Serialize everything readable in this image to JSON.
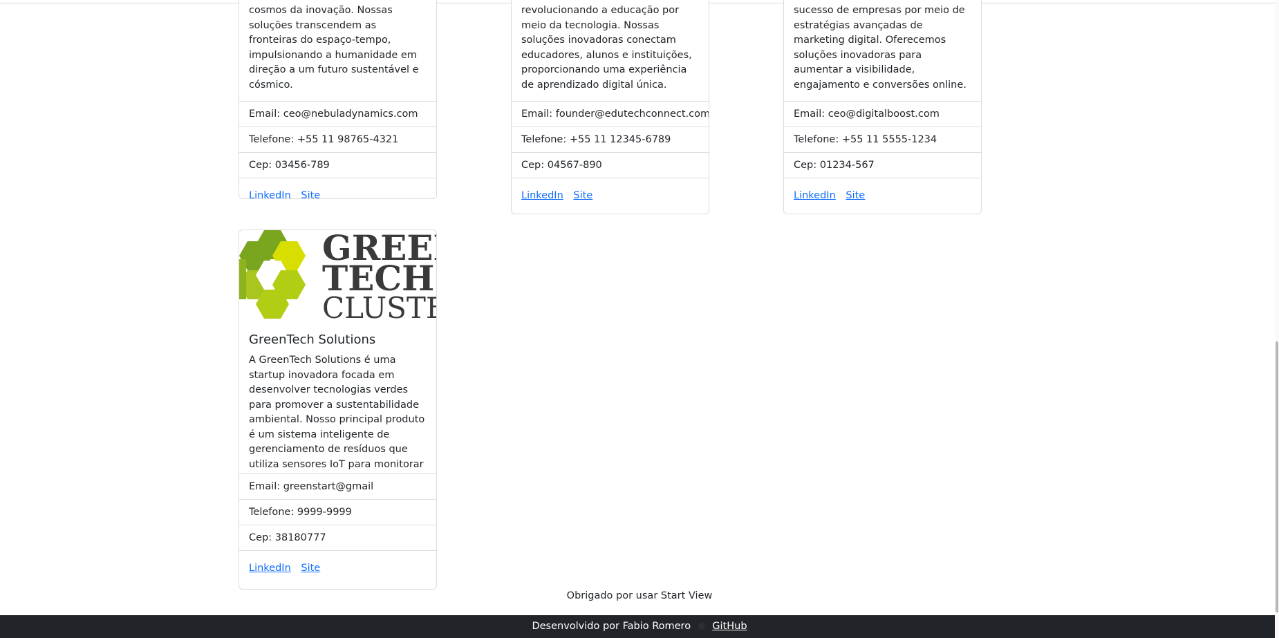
{
  "cards": [
    {
      "text": "cosmos da inovação. Nossas soluções transcendem as fronteiras do espaço-tempo, impulsionando a humanidade em direção a um futuro sustentável e cósmico.",
      "email": "Email: ceo@nebuladynamics.com",
      "phone": "Telefone: +55 11 98765-4321",
      "cep": "Cep: 03456-789",
      "linkedin": "LinkedIn",
      "site": "Site"
    },
    {
      "text": "revolucionando a educação por meio da tecnologia. Nossas soluções inovadoras conectam educadores, alunos e instituições, proporcionando uma experiência de aprendizado digital única.",
      "email": "Email: founder@edutechconnect.com",
      "phone": "Telefone: +55 11 12345-6789",
      "cep": "Cep: 04567-890",
      "linkedin": "LinkedIn",
      "site": "Site"
    },
    {
      "text": "sucesso de empresas por meio de estratégias avançadas de marketing digital. Oferecemos soluções inovadoras para aumentar a visibilidade, engajamento e conversões online.",
      "email": "Email: ceo@digitalboost.com",
      "phone": "Telefone: +55 11 5555-1234",
      "cep": "Cep: 01234-567",
      "linkedin": "LinkedIn",
      "site": "Site"
    },
    {
      "logo_lines": [
        "GREEN",
        "TECH",
        "CLUSTER"
      ],
      "title": "GreenTech Solutions",
      "text": "A GreenTech Solutions é uma startup inovadora focada em desenvolver tecnologias verdes para promover a sustentabilidade ambiental. Nosso principal produto é um sistema inteligente de gerenciamento de resíduos que utiliza sensores IoT para monitorar e otimizar a coleta de resíduos em áreas urbanas.",
      "email": "Email: greenstart@gmail",
      "phone": "Telefone: 9999-9999",
      "cep": "Cep: 38180777",
      "linkedin": "LinkedIn",
      "site": "Site"
    }
  ],
  "thanks": "Obrigado por usar Start View",
  "footer": {
    "credit": "Desenvolvido por Fabio Romero",
    "github": "GitHub",
    "github_icon": "github-icon"
  },
  "colors": {
    "link": "#0d6efd",
    "footer_bg": "#212529",
    "logo_green_dark": "#7aa51f",
    "logo_green_mid": "#a8c61e",
    "logo_lime": "#d8de00"
  }
}
